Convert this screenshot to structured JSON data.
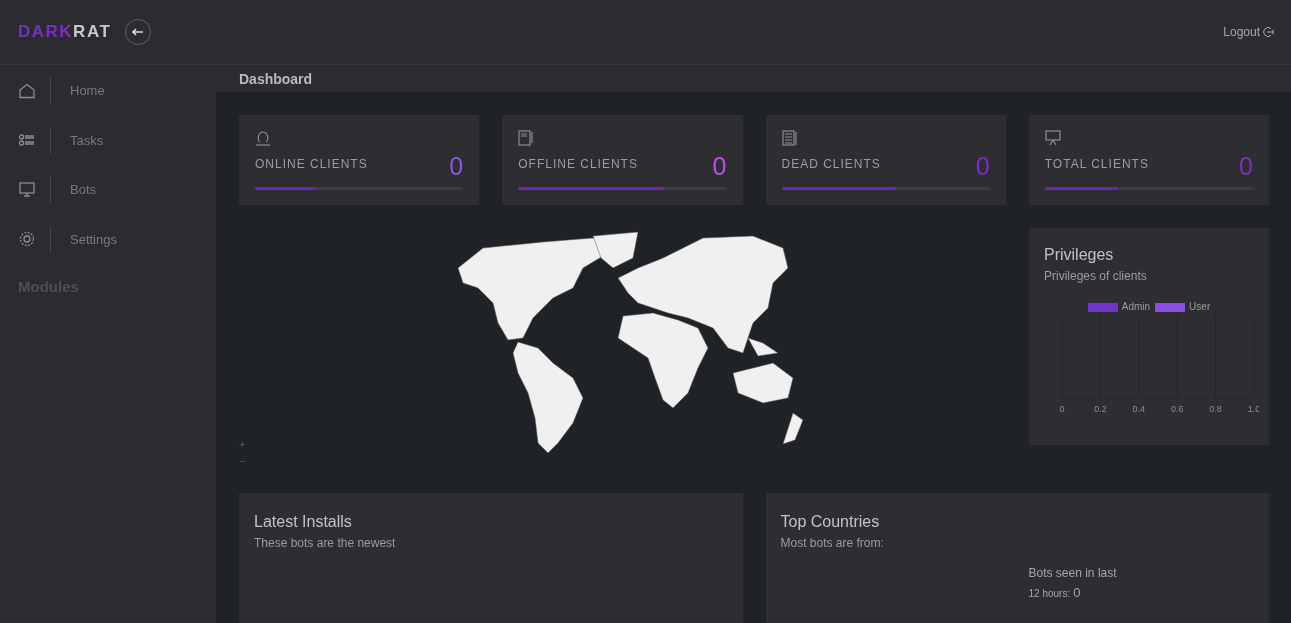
{
  "header": {
    "logo_part_1": "DARK",
    "logo_part_2": "RAT",
    "logout": "Logout"
  },
  "sidebar": {
    "items": [
      {
        "label": "Home"
      },
      {
        "label": "Tasks"
      },
      {
        "label": "Bots"
      },
      {
        "label": "Settings"
      }
    ],
    "section": "Modules"
  },
  "page_title": "Dashboard",
  "stats": [
    {
      "label": "ONLINE CLIENTS",
      "value": "0",
      "color": "#8b55e0",
      "level": 0.3
    },
    {
      "label": "OFFLINE CLIENTS",
      "value": "0",
      "color": "#c14fe6",
      "level": 0.7
    },
    {
      "label": "DEAD CLIENTS",
      "value": "0",
      "color": "#7b2fc2",
      "level": 0.55
    },
    {
      "label": "TOTAL CLIENTS",
      "value": "0",
      "color": "#7b2fc2",
      "level": 0.35
    }
  ],
  "map": {
    "zoom_in": "+",
    "zoom_out": "−"
  },
  "privileges": {
    "title": "Privileges",
    "subtitle": "Privileges of clients",
    "chart_data": {
      "type": "bar",
      "orientation": "horizontal",
      "grid": true,
      "series": [
        {
          "name": "Admin",
          "color": "#6f35c9"
        },
        {
          "name": "User",
          "color": "#8a4ee0"
        }
      ],
      "xlim": [
        0,
        1
      ],
      "xticks": [
        {
          "value": 0,
          "label": "0"
        },
        {
          "value": 0.2,
          "label": "0.2"
        },
        {
          "value": 0.4,
          "label": "0.4"
        },
        {
          "value": 0.6,
          "label": "0.6"
        },
        {
          "value": 0.8,
          "label": "0.8"
        },
        {
          "value": 1,
          "label": "1.0"
        }
      ]
    }
  },
  "latest_installs": {
    "title": "Latest Installs",
    "subtitle": "These bots are the newest"
  },
  "top_countries": {
    "title": "Top Countries",
    "subtitle": "Most bots are from:",
    "seen_heading": "Bots seen in last",
    "seen_rows": [
      {
        "label": "12 hours:",
        "value": "0"
      }
    ]
  }
}
